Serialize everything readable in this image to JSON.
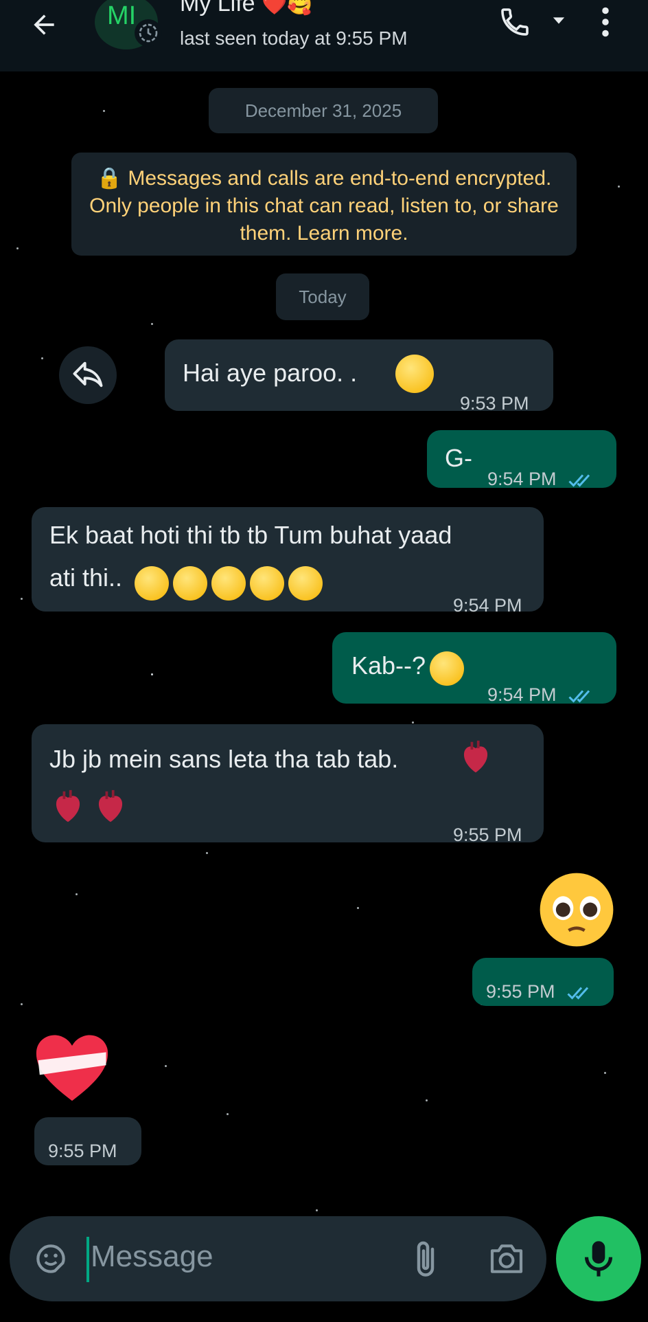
{
  "header": {
    "avatar_initials": "MI",
    "title": "My Life",
    "title_emoji": "❤️🥰",
    "subtitle": "last seen today at 9:55 PM"
  },
  "date_chips": {
    "first": "December 31, 2025",
    "second": "Today"
  },
  "encryption_notice": "🔒 Messages and calls are end-to-end encrypted. Only people in this chat can read, listen to, or share them. Learn more.",
  "messages": [
    {
      "direction": "in",
      "text": "Hai aye paroo. .",
      "time": "9:53 PM"
    },
    {
      "direction": "out",
      "text": "G-",
      "time": "9:54 PM"
    },
    {
      "direction": "in",
      "text_line1": "Ek baat hoti thi tb tb Tum buhat yaad",
      "text_line2": "ati thi..",
      "time": "9:54 PM"
    },
    {
      "direction": "out",
      "text": "Kab--?",
      "time": "9:54 PM"
    },
    {
      "direction": "in",
      "text": "Jb jb mein sans leta tha tab tab.",
      "time": "9:55 PM"
    },
    {
      "direction": "out",
      "emoji": "🥺",
      "time": "9:55 PM"
    },
    {
      "direction": "in",
      "emoji": "❤️‍🩹",
      "time": "9:55 PM"
    }
  ],
  "composer": {
    "placeholder": "Message"
  },
  "colors": {
    "header_bg": "#0b141a",
    "incoming_bubble": "#1f2c34",
    "outgoing_bubble": "#005c4b",
    "accent_green": "#21c063",
    "read_ticks": "#53bdeb",
    "encryption_text": "#ffd279"
  },
  "icons": [
    "back-arrow-icon",
    "status-ring-icon",
    "phone-icon",
    "chevron-down-icon",
    "more-vert-icon",
    "reply-icon",
    "sticker-icon",
    "attach-icon",
    "camera-icon",
    "mic-icon",
    "double-check-icon"
  ]
}
